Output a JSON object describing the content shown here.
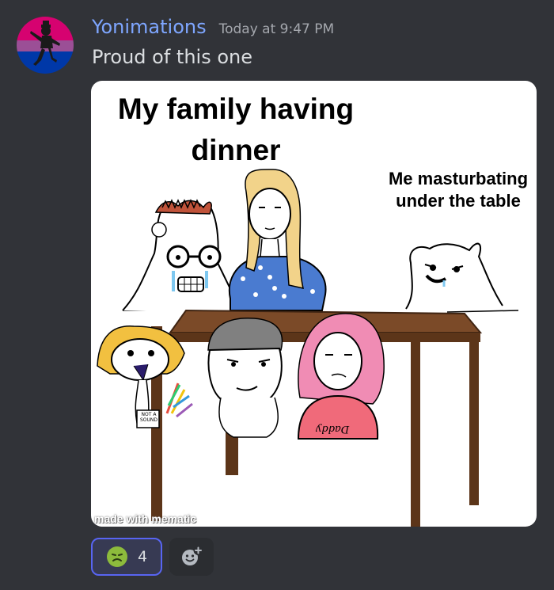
{
  "message": {
    "author": "Yonimations",
    "timestamp": "Today at 9:47 PM",
    "text": "Proud of this one",
    "avatar_icon": "dancing-figure-avatar-icon"
  },
  "meme": {
    "title": "My family having dinner",
    "caption": "Me masturbating under the table",
    "shirt_text": "Daddy",
    "sign_text": "NOT A SOUND",
    "watermark": "made with mematic"
  },
  "reactions": [
    {
      "emoji_name": "nauseated-face-icon",
      "count": "4",
      "selected": true
    }
  ],
  "add_reaction_icon": "add-reaction-icon",
  "colors": {
    "background": "#313338",
    "username": "#7ea6ff",
    "reaction_border": "#5865f2",
    "avatar_bands": [
      "#d60270",
      "#9b4f96",
      "#0038a8"
    ]
  }
}
